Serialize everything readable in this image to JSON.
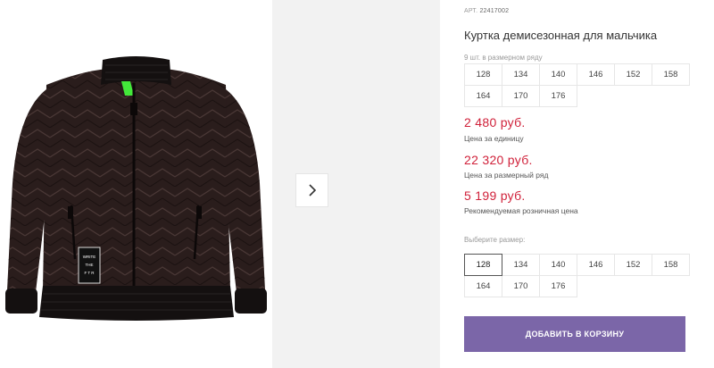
{
  "product": {
    "article_label": "АРТ.",
    "article_number": "22417002",
    "title": "Куртка демисезонная для мальчика",
    "image_alt": "jacket-photo",
    "patch_text": [
      "WRITE",
      "THE",
      "F T R"
    ]
  },
  "size_row": {
    "hint": "9 шт. в размерном ряду",
    "sizes": [
      "128",
      "134",
      "140",
      "146",
      "152",
      "158",
      "164",
      "170",
      "176"
    ]
  },
  "prices": {
    "unit_price": "2 480 руб.",
    "unit_label": "Цена за единицу",
    "row_price": "22 320 руб.",
    "row_label": "Цена за размерный ряд",
    "retail_price": "5 199 руб.",
    "retail_label": "Рекомендуемая розничная цена"
  },
  "size_select": {
    "hint": "Выберите размер:",
    "sizes": [
      "128",
      "134",
      "140",
      "146",
      "152",
      "158",
      "164",
      "170",
      "176"
    ],
    "selected": "128"
  },
  "cart": {
    "add_label": "ДОБАВИТЬ В КОРЗИНУ"
  },
  "colors": {
    "price": "#d0213a",
    "button": "#7b66a8",
    "jacket": "#2a1d1c",
    "zipper_tape": "#43e83a"
  }
}
